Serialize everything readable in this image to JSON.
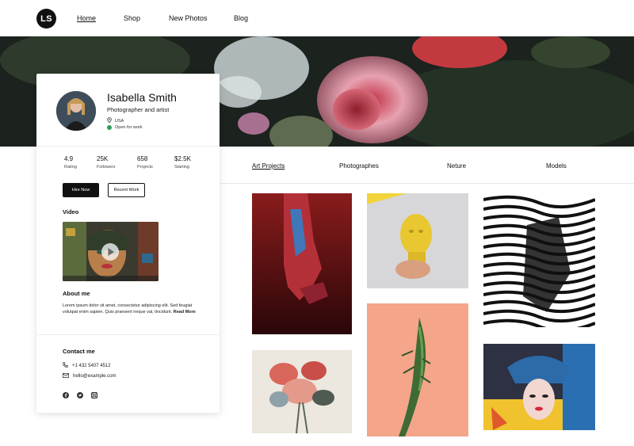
{
  "nav": {
    "logo": "LS",
    "links": [
      "Home",
      "Shop",
      "New Photos",
      "Blog"
    ],
    "active": "Home"
  },
  "profile": {
    "name": "Isabella Smith",
    "role": "Photographer and artist",
    "location": "USA",
    "status": "Open for work",
    "stats": [
      {
        "value": "4.9",
        "label": "Rating"
      },
      {
        "value": "25K",
        "label": "Followers"
      },
      {
        "value": "658",
        "label": "Projects"
      },
      {
        "value": "$2.5K",
        "label": "Starting"
      }
    ],
    "buttons": {
      "hire": "Hire Now",
      "recent": "Recent Work"
    },
    "video_heading": "Video",
    "about_heading": "About me",
    "about_text": "Lorem ipsum dolor sit amet, consectetur adipiscing elit. Sed feugiat volutpat enim sapien. Quis praesent neque val, tincidunt.",
    "about_more": "Read More",
    "contact_heading": "Contact me",
    "phone": "+1 432 5407 4512",
    "email": "hello@example.com"
  },
  "tabs": [
    "Art Projects",
    "Photographes",
    "Neture",
    "Models"
  ],
  "active_tab": "Art Projects",
  "colors": {
    "accent": "#111111",
    "status": "#2f9e5b"
  },
  "icons": [
    "location-pin-icon",
    "phone-icon",
    "mail-icon",
    "facebook-icon",
    "twitter-icon",
    "instagram-icon",
    "play-icon"
  ]
}
